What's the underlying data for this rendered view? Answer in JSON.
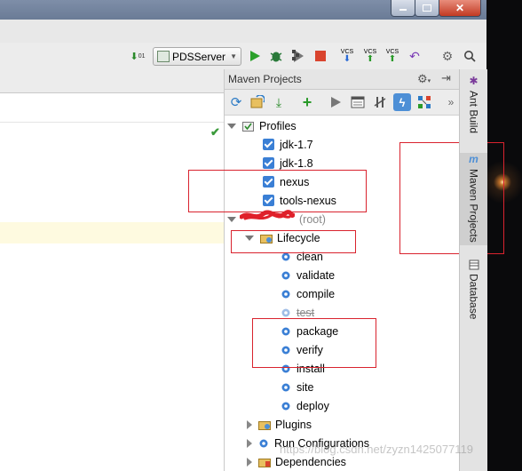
{
  "toolbar": {
    "run_config_label": "PDSServer",
    "icons": [
      "sort-icon",
      "run-icon",
      "debug-icon",
      "coverage-icon",
      "stop-icon",
      "vcs-update-icon",
      "vcs-commit-icon",
      "vcs-push-icon",
      "revert-icon",
      "settings-icon",
      "search-icon"
    ],
    "vcs_label": "VCS",
    "sort_label": "01"
  },
  "maven_panel": {
    "title": "Maven Projects",
    "toolbar_icons": [
      "refresh-icon",
      "generate-sources-icon",
      "download-icon",
      "add-icon",
      "run-goal-icon",
      "execute-icon",
      "toggle-offline-icon",
      "skip-tests-icon",
      "show-dependencies-icon",
      "more-icon"
    ],
    "tree": {
      "profiles_label": "Profiles",
      "profiles": [
        {
          "label": "jdk-1.7",
          "checked": true
        },
        {
          "label": "jdk-1.8",
          "checked": true
        },
        {
          "label": "nexus",
          "checked": true
        },
        {
          "label": "tools-nexus",
          "checked": true
        }
      ],
      "project_suffix": "(root)",
      "lifecycle_label": "Lifecycle",
      "lifecycle_goals": [
        {
          "label": "clean",
          "skipped": false
        },
        {
          "label": "validate",
          "skipped": false
        },
        {
          "label": "compile",
          "skipped": false
        },
        {
          "label": "test",
          "skipped": true
        },
        {
          "label": "package",
          "skipped": false
        },
        {
          "label": "verify",
          "skipped": false
        },
        {
          "label": "install",
          "skipped": false
        },
        {
          "label": "site",
          "skipped": false
        },
        {
          "label": "deploy",
          "skipped": false
        }
      ],
      "plugins_label": "Plugins",
      "run_configurations_label": "Run Configurations",
      "dependencies_label": "Dependencies"
    }
  },
  "side_tabs": [
    {
      "label": "Ant Build"
    },
    {
      "label": "Maven Projects"
    },
    {
      "label": "Database"
    }
  ],
  "watermark": "https://blog.csdn.net/zyzn1425077119",
  "colors": {
    "accent_check": "#3a7fd5",
    "annotation_red": "#d9232e",
    "run_green": "#2aa02a",
    "stop_red": "#d9442e"
  }
}
